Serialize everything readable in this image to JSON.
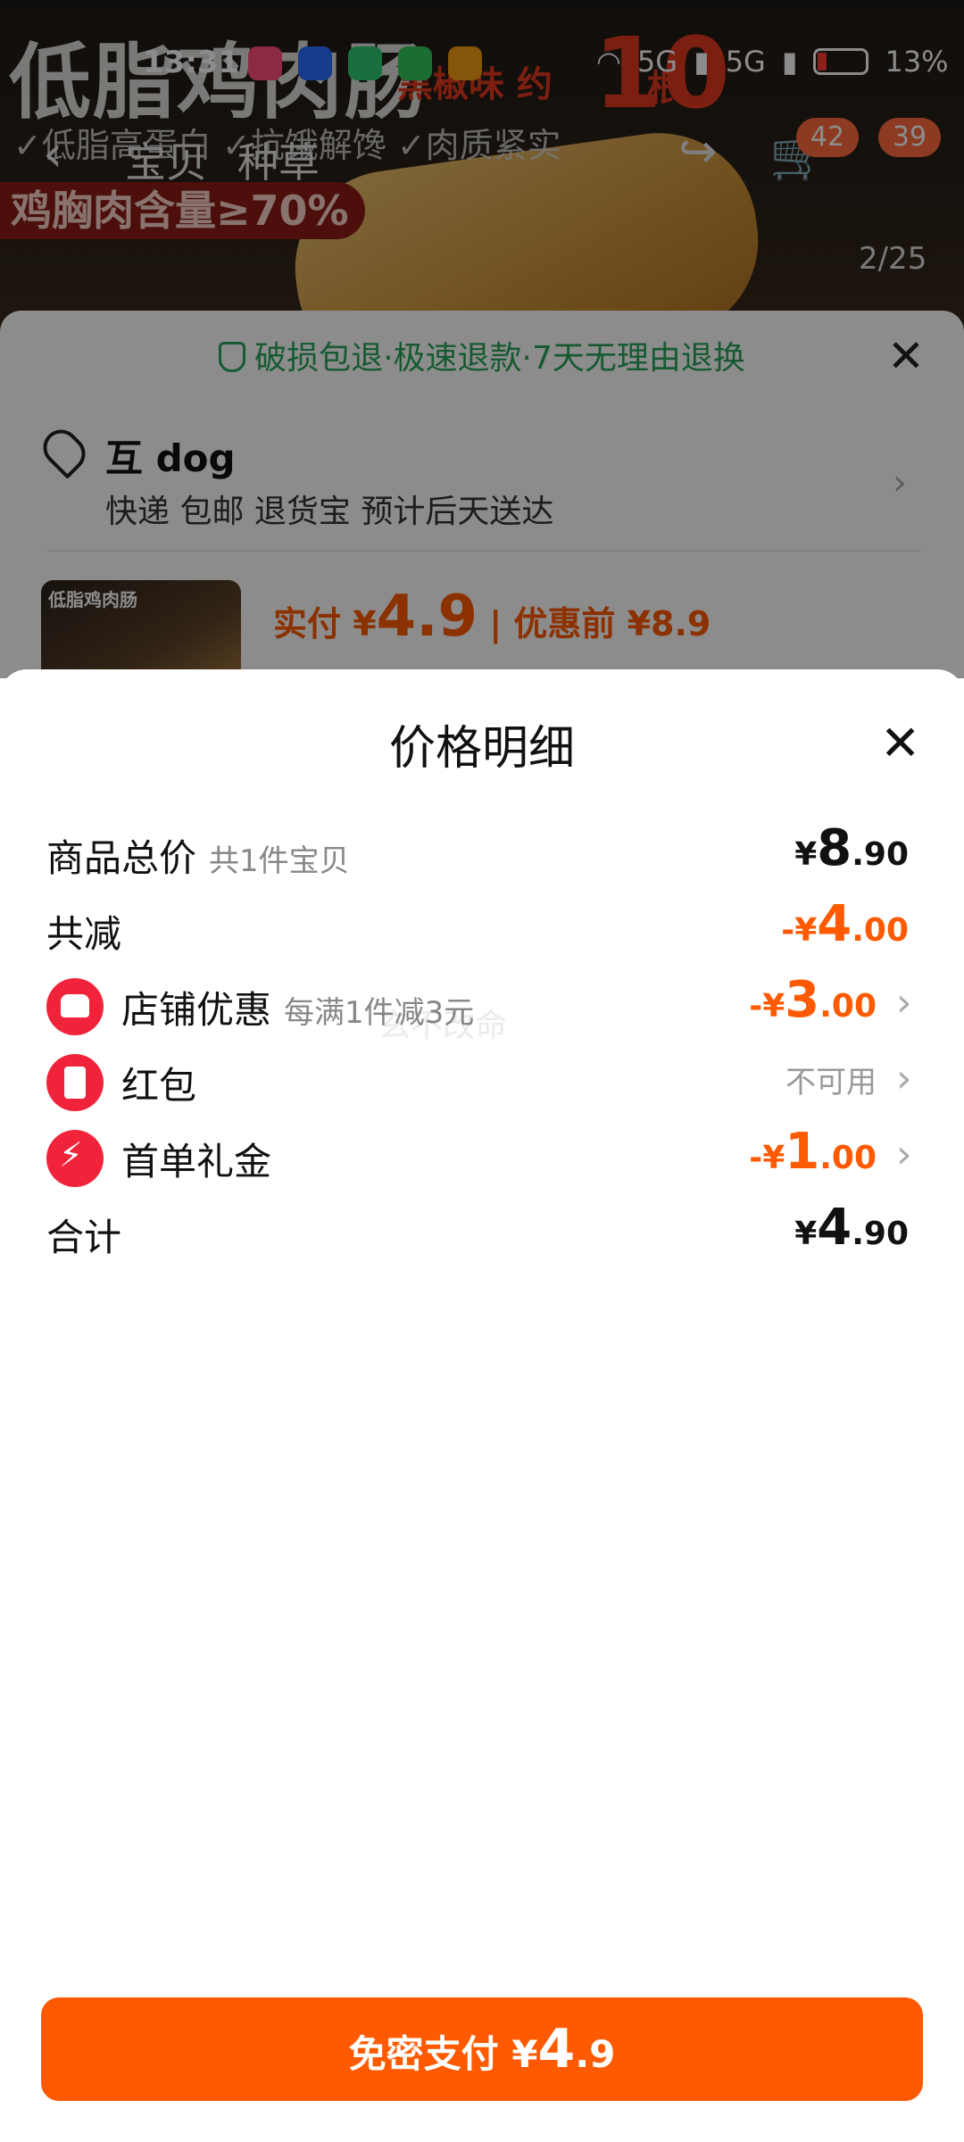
{
  "status_bar": {
    "time": "13:31",
    "network1": "5G",
    "network2": "5G",
    "battery": "13%"
  },
  "background": {
    "product_title": "低脂鸡肉肠",
    "flavor_tag": "黑椒味 约",
    "count_num": "10",
    "count_unit": "根",
    "features": "✓低脂高蛋白 ✓抗饿解馋 ✓肉质紧实",
    "chicken_content": "鸡胸肉含量≥70%",
    "nav_tabs": [
      "宝贝",
      "种草"
    ],
    "cart_badge": "42",
    "more_badge": "39",
    "image_counter": "2/25",
    "guarantee": "破损包退·极速退款·7天无理由退换",
    "address_name": "互 dog",
    "address_desc": "快递 包邮 退货宝 预计后天送达",
    "pay_label": "实付 ¥",
    "pay_big": "4.9",
    "pay_before": "| 优惠前 ¥8.9"
  },
  "sheet": {
    "title": "价格明细",
    "rows": [
      {
        "label": "商品总价",
        "sub": "共1件宝贝",
        "currency": "¥",
        "big": "8",
        "small": ".90"
      },
      {
        "label": "共减",
        "currency": "-¥",
        "big": "4",
        "small": ".00"
      },
      {
        "label": "店铺优惠",
        "sub": "每满1件减3元",
        "currency": "-¥",
        "big": "3",
        "small": ".00"
      },
      {
        "label": "红包",
        "value": "不可用"
      },
      {
        "label": "首单礼金",
        "currency": "-¥",
        "big": "1",
        "small": ".00"
      },
      {
        "label": "合计",
        "currency": "¥",
        "big": "4",
        "small": ".90"
      }
    ],
    "watermark": "玄不改命",
    "pay_button": {
      "text": "免密支付 ¥",
      "big": "4",
      "small": ".9"
    }
  },
  "colors": {
    "accent": "#ff5a00",
    "coupon_red": "#f0233a",
    "guarantee_green": "#2aa55a"
  }
}
